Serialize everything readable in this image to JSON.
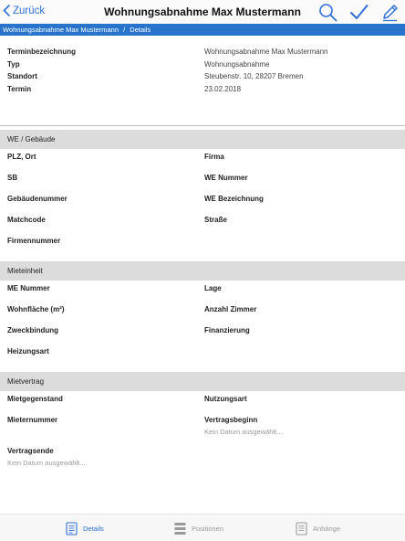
{
  "nav": {
    "back_label": "Zurück",
    "title": "Wohnungsabnahme Max Mustermann"
  },
  "breadcrumb": {
    "parent": "Wohnungsabnahme Max Mustermann",
    "separator": "/",
    "current": "Details"
  },
  "summary": {
    "rows": [
      {
        "label": "Terminbezeichnung",
        "value": "Wohnungsabnahme Max Mustermann"
      },
      {
        "label": "Typ",
        "value": "Wohnungsabnahme"
      },
      {
        "label": "Standort",
        "value": "Steubenstr. 10, 28207 Bremen"
      },
      {
        "label": "Termin",
        "value": "23.02.2018"
      }
    ]
  },
  "sections": {
    "we": {
      "title": "WE / Gebäude",
      "fields": [
        "PLZ, Ort",
        "Firma",
        "SB",
        "WE Nummer",
        "Gebäudenummer",
        "WE Bezeichnung",
        "Matchcode",
        "Straße",
        "Firmennummer"
      ]
    },
    "mieteinheit": {
      "title": "Mieteinheit",
      "fields": [
        "ME Nummer",
        "Lage",
        "Wohnfläche (m²)",
        "Anzahl Zimmer",
        "Zweckbindung",
        "Finanzierung",
        "Heizungsart"
      ]
    },
    "mietvertrag": {
      "title": "Mietvertrag",
      "fields": [
        "Mietgegenstand",
        "Nutzungsart",
        "Mieternummer",
        "Vertragsbeginn",
        "Vertragsende"
      ],
      "date_placeholder": "Kein Datum ausgewählt..."
    }
  },
  "tabs": [
    {
      "label": "Details"
    },
    {
      "label": "Positionen"
    },
    {
      "label": "Anhänge"
    }
  ],
  "colors": {
    "accent": "#2f6fd6",
    "breadcrumb_bg": "#2874cc",
    "section_bg": "#dcdcdc"
  }
}
